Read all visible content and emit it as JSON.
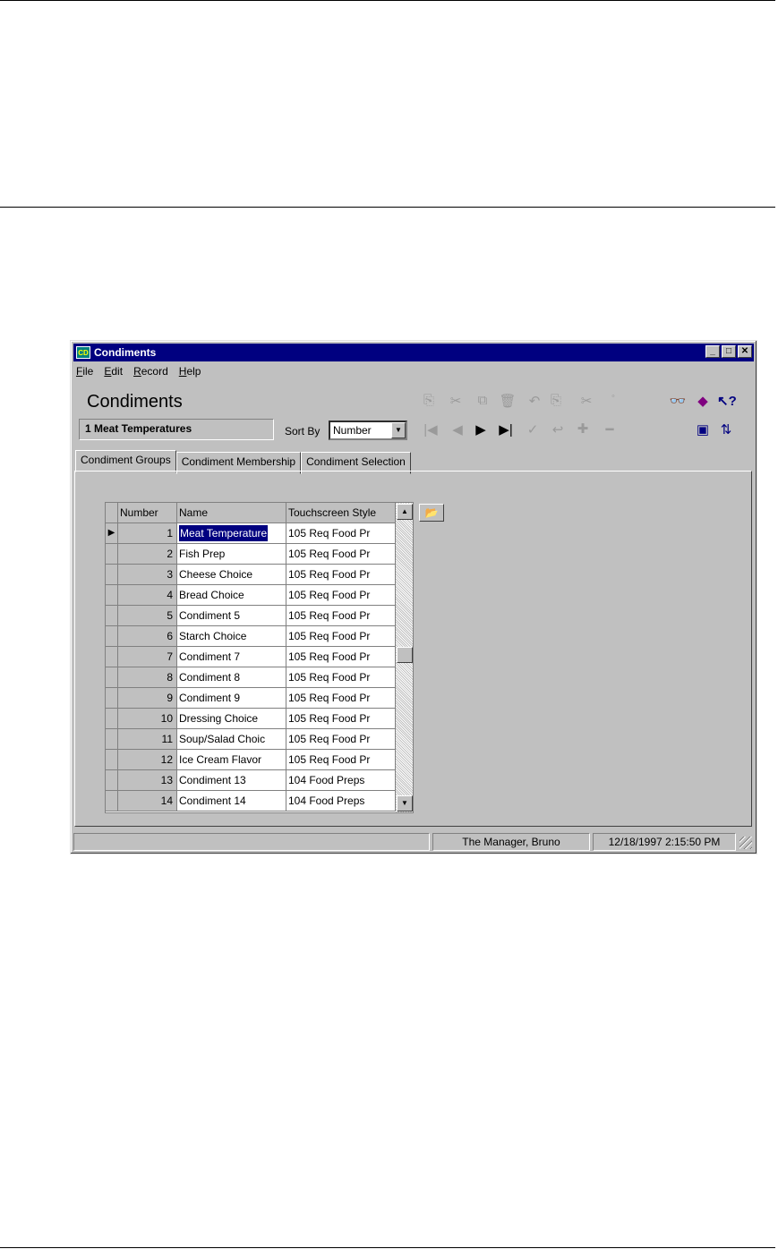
{
  "window": {
    "title": "Condiments",
    "icon_label": "CD",
    "minimize_glyph": "_",
    "maximize_glyph": "□",
    "close_glyph": "✕"
  },
  "menubar": [
    "File",
    "Edit",
    "Record",
    "Help"
  ],
  "header": {
    "title": "Condiments",
    "current_record": "1 Meat Temperatures",
    "sort_by_label": "Sort By",
    "sort_by_value": "Number"
  },
  "toolbar_icons": [
    "copy-icon",
    "cut-icon",
    "paste-icon",
    "delete-icon",
    "undo-icon",
    "copy-record-icon",
    "paste-record-icon",
    "select-icon",
    "first-record-icon",
    "previous-record-icon",
    "next-record-icon",
    "last-record-icon",
    "post-icon",
    "cancel-icon",
    "add-record-icon",
    "delete-record-icon",
    "find-icon",
    "book-icon",
    "help-pointer-icon",
    "monitor-icon",
    "refresh-icon"
  ],
  "tabs": [
    "Condiment Groups",
    "Condiment Membership",
    "Condiment Selection"
  ],
  "grid": {
    "columns": [
      "Number",
      "Name",
      "Touchscreen Style"
    ],
    "rows": [
      {
        "number": "1",
        "name": "Meat Temperature",
        "style": "105  Req Food Pr"
      },
      {
        "number": "2",
        "name": "Fish Prep",
        "style": "105  Req Food Pr"
      },
      {
        "number": "3",
        "name": "Cheese Choice",
        "style": "105  Req Food Pr"
      },
      {
        "number": "4",
        "name": "Bread Choice",
        "style": "105  Req Food Pr"
      },
      {
        "number": "5",
        "name": "Condiment 5",
        "style": "105  Req Food Pr"
      },
      {
        "number": "6",
        "name": "Starch Choice",
        "style": "105  Req Food Pr"
      },
      {
        "number": "7",
        "name": "Condiment 7",
        "style": "105  Req Food Pr"
      },
      {
        "number": "8",
        "name": "Condiment 8",
        "style": "105  Req Food Pr"
      },
      {
        "number": "9",
        "name": "Condiment 9",
        "style": "105  Req Food Pr"
      },
      {
        "number": "10",
        "name": "Dressing Choice",
        "style": "105  Req Food Pr"
      },
      {
        "number": "11",
        "name": "Soup/Salad Choic",
        "style": "105  Req Food Pr"
      },
      {
        "number": "12",
        "name": "Ice Cream Flavor",
        "style": "105  Req Food Pr"
      },
      {
        "number": "13",
        "name": "Condiment 13",
        "style": "104  Food Preps"
      },
      {
        "number": "14",
        "name": "Condiment 14",
        "style": "104  Food Preps"
      }
    ]
  },
  "status": {
    "section1": "",
    "user": "The Manager, Bruno",
    "datetime": "12/18/1997 2:15:50 PM"
  },
  "colors": {
    "titlebar": "#000080",
    "face": "#c0c0c0",
    "selection": "#000080"
  }
}
